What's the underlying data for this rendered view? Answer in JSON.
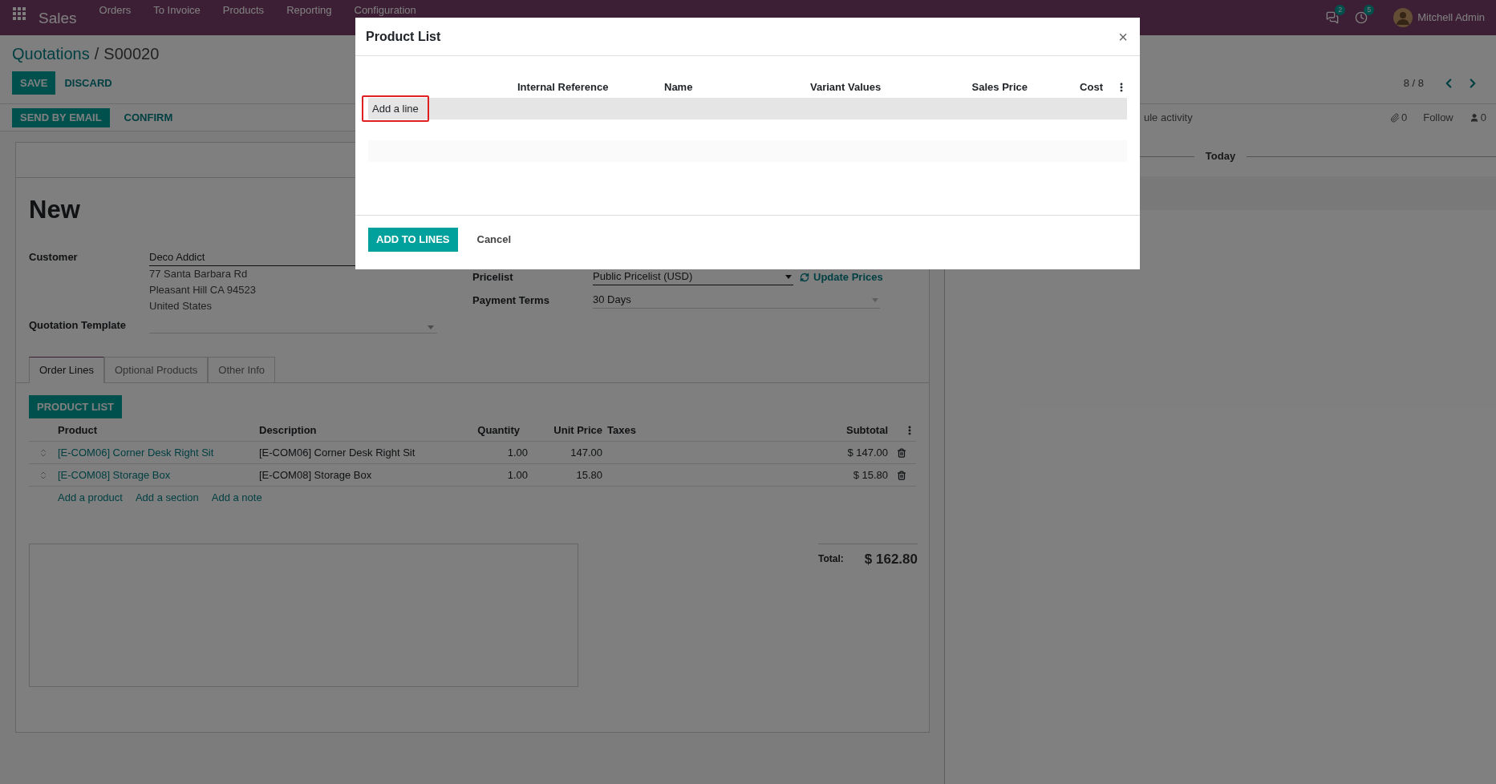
{
  "navbar": {
    "app": "Sales",
    "menu": [
      "Orders",
      "To Invoice",
      "Products",
      "Reporting",
      "Configuration"
    ],
    "messages_count": "2",
    "activities_count": "5",
    "user": "Mitchell Admin"
  },
  "breadcrumb": {
    "parent": "Quotations",
    "separator": "/",
    "current": "S00020"
  },
  "actions": [
    {
      "label": "SAVE",
      "primary": true
    },
    {
      "label": "DISCARD",
      "primary": false
    }
  ],
  "status_buttons": [
    {
      "label": "SEND BY EMAIL",
      "primary": true
    },
    {
      "label": "CONFIRM",
      "primary": false
    }
  ],
  "pager": "8 / 8",
  "chatter": {
    "activity": "ule activity",
    "attachments": "0",
    "follow": "Follow",
    "followers": "0",
    "divider": "Today"
  },
  "form": {
    "title": "New",
    "customer": {
      "label": "Customer",
      "value": "Deco Addict",
      "address": [
        "77 Santa Barbara Rd",
        "Pleasant Hill CA 94523",
        "United States"
      ]
    },
    "quotation_template": {
      "label": "Quotation Template"
    },
    "pricelist": {
      "label": "Pricelist",
      "value": "Public Pricelist (USD)",
      "action": "Update Prices"
    },
    "payment_terms": {
      "label": "Payment Terms",
      "value": "30 Days"
    }
  },
  "tabs": [
    {
      "label": "Order Lines",
      "selected": true
    },
    {
      "label": "Optional Products",
      "selected": false
    },
    {
      "label": "Other Info",
      "selected": false
    }
  ],
  "product_list_button": "PRODUCT LIST",
  "order_lines": {
    "columns": [
      "Product",
      "Description",
      "Quantity",
      "Unit Price",
      "Taxes",
      "Subtotal"
    ],
    "rows": [
      {
        "product": "[E-COM06] Corner Desk Right Sit",
        "description": "[E-COM06] Corner Desk Right Sit",
        "quantity": "1.00",
        "unit_price": "147.00",
        "subtotal": "$ 147.00"
      },
      {
        "product": "[E-COM08] Storage Box",
        "description": "[E-COM08] Storage Box",
        "quantity": "1.00",
        "unit_price": "15.80",
        "subtotal": "$ 15.80"
      }
    ],
    "add_links": [
      "Add a product",
      "Add a section",
      "Add a note"
    ]
  },
  "total": {
    "label": "Total:",
    "value": "$ 162.80"
  },
  "dialog": {
    "title": "Product List",
    "close": "×",
    "columns": [
      "Internal Reference",
      "Name",
      "Variant Values",
      "Sales Price",
      "Cost"
    ],
    "add_line": "Add a line",
    "buttons": [
      {
        "label": "ADD TO LINES",
        "primary": true
      },
      {
        "label": "Cancel",
        "primary": false
      }
    ]
  }
}
